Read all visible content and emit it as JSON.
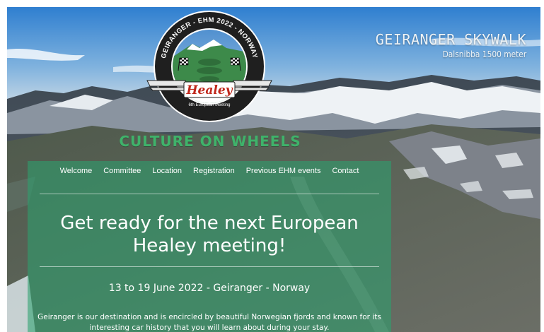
{
  "hero": {
    "skywalk_title": "GEIRANGER SKYWALK",
    "skywalk_subtitle": "Dalsnibba 1500 meter"
  },
  "logo": {
    "ring_text": "GEIRANGER - EHM 2022 - NORWAY",
    "brand": "Healey",
    "meeting": "6th European Meeting"
  },
  "tagline": "CULTURE ON WHEELS",
  "nav": {
    "items": [
      "Welcome",
      "Committee",
      "Location",
      "Registration",
      "Previous EHM events",
      "Contact"
    ]
  },
  "main": {
    "headline": "Get ready for the next European Healey meeting!",
    "dates": "13 to 19 June 2022 - Geiranger - Norway",
    "intro": "Geiranger is our destination and is encircled by beautiful Norwegian fjords and known for its interesting car history that you will learn about during your stay."
  },
  "colors": {
    "panel": "#2ca06e",
    "tagline": "#3fb26a",
    "logo_ring": "#1f1f1f",
    "brand_red": "#c0281c"
  }
}
